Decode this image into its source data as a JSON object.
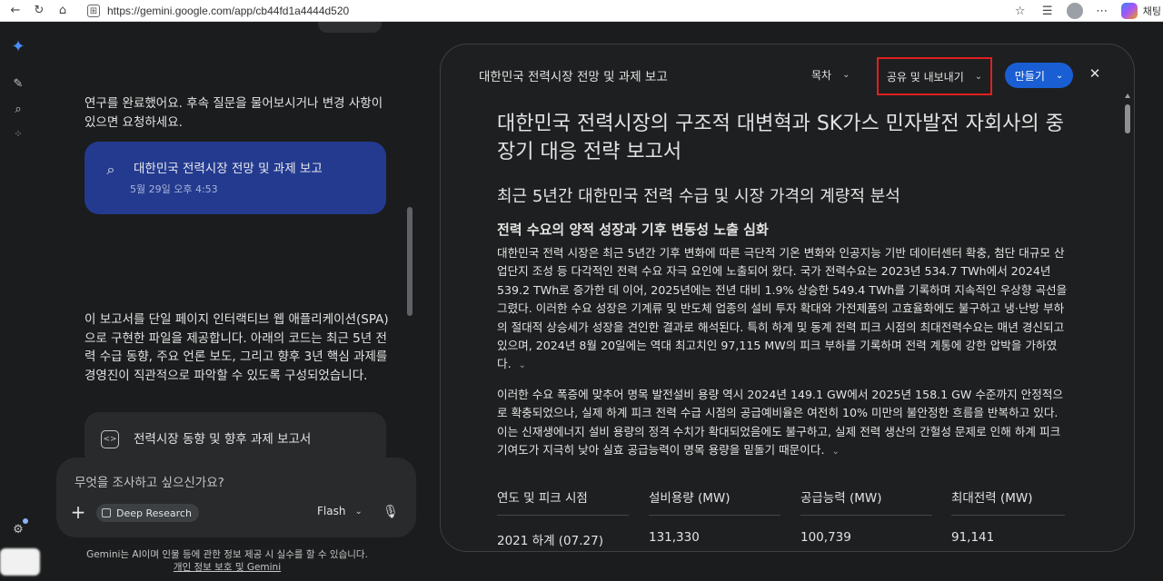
{
  "browser": {
    "url": "https://gemini.google.com/app/cb44fd1a4444d520",
    "chat_label_cut": "채팅"
  },
  "left": {
    "message_top": "연구를 완료했어요. 후속 질문을 물어보시거나 변경 사항이 있으면 요청하세요.",
    "report_card": {
      "title": "대한민국 전력시장 전망 및 과제 보고",
      "date": "5월 29일 오후 4:53"
    },
    "message_mid": "이 보고서를 단일 페이지 인터랙티브 웹 애플리케이션(SPA)으로 구현한 파일을 제공합니다. 아래의 코드는 최근 5년 전력 수급 동향, 주요 언론 보도, 그리고 향후 3년 핵심 과제를 경영진이 직관적으로 파악할 수 있도록 구성되었습니다.",
    "code_card": {
      "title": "전력시장 동향 및 향후 과제 보고서"
    },
    "input": {
      "placeholder": "무엇을 조사하고 싶으신가요?",
      "chip_label": "Deep Research",
      "model": "Flash"
    },
    "disclaimer": "Gemini는 AI이며 인물 등에 관한 정보 제공 시 실수를 할 수 있습니다.",
    "disclaimer_link": "개인 정보 보호 및 Gemini"
  },
  "panel": {
    "title": "대한민국 전력시장 전망 및 과제 보고",
    "toc_label": "목차",
    "share_label": "공유 및 내보내기",
    "make_label": "만들기",
    "h1": "대한민국 전력시장의 구조적 대변혁과 SK가스 민자발전 자회사의 중장기 대응 전략 보고서",
    "h2": "최근 5년간 대한민국 전력 수급 및 시장 가격의 계량적 분석",
    "h3": "전력 수요의 양적 성장과 기후 변동성 노출 심화",
    "p1": "대한민국 전력 시장은 최근 5년간 기후 변화에 따른 극단적 기온 변화와 인공지능 기반 데이터센터 확충, 첨단 대규모 산업단지 조성 등 다각적인 전력 수요 자극 요인에 노출되어 왔다. 국가 전력수요는 2023년 534.7 TWh에서 2024년 539.2 TWh로 증가한 데 이어, 2025년에는 전년 대비 1.9% 상승한 549.4 TWh를 기록하며 지속적인 우상향 곡선을 그렸다. 이러한 수요 성장은 기계류 및 반도체 업종의 설비 투자 확대와 가전제품의 고효율화에도 불구하고 냉·난방 부하의 절대적 상승세가 성장을 견인한 결과로 해석된다. 특히 하계 및 동계 전력 피크 시점의 최대전력수요는 매년 경신되고 있으며, 2024년 8월 20일에는 역대 최고치인 97,115 MW의 피크 부하를 기록하며 전력 계통에 강한 압박을 가하였다.",
    "p2": "이러한 수요 폭증에 맞추어 명목 발전설비 용량 역시 2024년 149.1 GW에서 2025년 158.1 GW 수준까지 안정적으로 확충되었으나, 실제 하계 피크 전력 수급 시점의 공급예비율은 여전히 10% 미만의 불안정한 흐름을 반복하고 있다. 이는 신재생에너지 설비 용량의 정격 수치가 확대되었음에도 불구하고, 실제 전력 생산의 간헐성 문제로 인해 하계 피크 기여도가 지극히 낮아 실효 공급능력이 명목 용량을 밑돌기 때문이다.",
    "table": {
      "headers": [
        "연도 및 피크 시점",
        "설비용량 (MW)",
        "공급능력 (MW)",
        "최대전력 (MW)"
      ],
      "rows": [
        [
          "2021 하계 (07.27)",
          "131,330",
          "100,739",
          "91,141"
        ]
      ]
    }
  },
  "colors": {
    "background": "#1b1c1d",
    "panel": "#1e1f20",
    "report_card": "#233a8f",
    "make_button": "#1a5ed3",
    "highlight_box": "#e02020"
  },
  "icons": {
    "gemini_logo": "gemini-sparkle-icon",
    "new_chat": "edit-icon",
    "search": "search-icon",
    "apps": "apps-icon",
    "settings": "gear-icon"
  }
}
